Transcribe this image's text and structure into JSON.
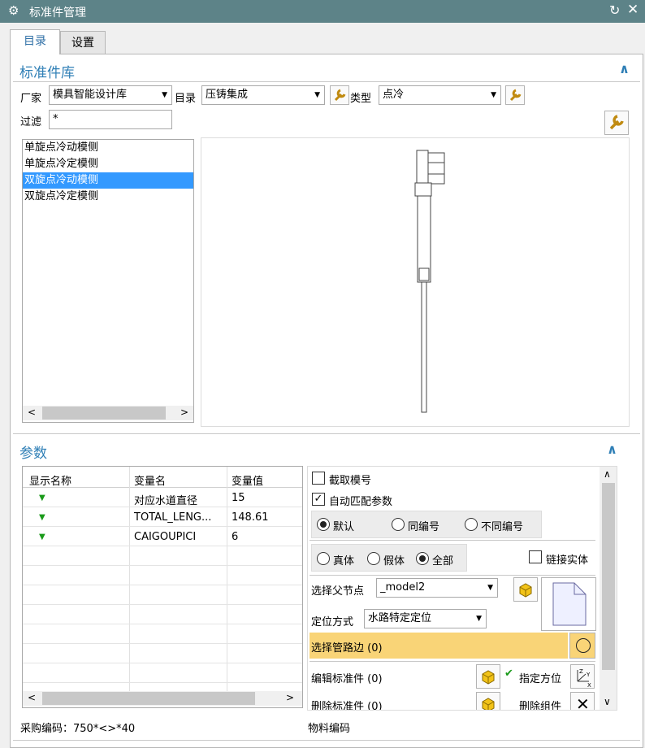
{
  "window": {
    "title": "标准件管理"
  },
  "tabs": [
    {
      "label": "目录"
    },
    {
      "label": "设置"
    }
  ],
  "library": {
    "title": "标准件库",
    "vendor_label": "厂家",
    "vendor_value": "模具智能设计库",
    "catalog_label": "目录",
    "catalog_value": "压铸集成",
    "type_label": "类型",
    "type_value": "点冷",
    "filter_label": "过滤",
    "filter_value": "*",
    "items": [
      {
        "label": "单旋点冷动模侧"
      },
      {
        "label": "单旋点冷定模侧"
      },
      {
        "label": "双旋点冷动模侧"
      },
      {
        "label": "双旋点冷定模侧"
      }
    ],
    "selected_index": 2
  },
  "params": {
    "title": "参数",
    "columns": [
      "显示名称",
      "变量名",
      "变量值"
    ],
    "rows": [
      {
        "var": "对应水道直径",
        "value": "15"
      },
      {
        "var": "TOTAL_LENG...",
        "value": "148.61"
      },
      {
        "var": "CAIGOUPICI",
        "value": "6"
      }
    ],
    "truncate_label": "截取模号",
    "truncate_checked": false,
    "auto_match_label": "自动匹配参数",
    "auto_match_checked": true,
    "mode_options": [
      "默认",
      "同编号",
      "不同编号"
    ],
    "body_options": [
      "真体",
      "假体",
      "全部"
    ],
    "link_solid_label": "链接实体",
    "parent_label": "选择父节点",
    "parent_value": "_model2",
    "position_label": "定位方式",
    "position_value": "水路特定定位",
    "pipe_edge_label": "选择管路边 (0)",
    "edit_label": "编辑标准件 (0)",
    "orient_label": "指定方位",
    "delete_label": "删除标准件 (0)",
    "delete_comp_label": "删除组件"
  },
  "footer": {
    "purchase_code": "采购编码：750*<>*40",
    "material_code": "物料编码"
  }
}
